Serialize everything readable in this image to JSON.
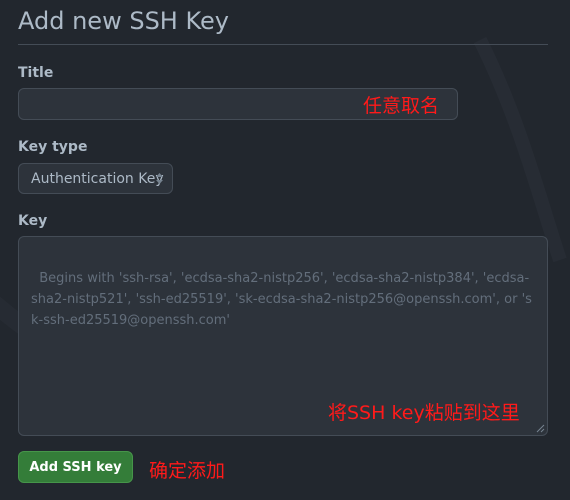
{
  "page": {
    "title": "Add new SSH Key"
  },
  "form": {
    "title_label": "Title",
    "title_value": "",
    "key_type_label": "Key type",
    "key_type_selected": "Authentication Key",
    "key_label": "Key",
    "key_placeholder": "Begins with 'ssh-rsa', 'ecdsa-sha2-nistp256', 'ecdsa-sha2-nistp384', 'ecdsa-sha2-nistp521', 'ssh-ed25519', 'sk-ecdsa-sha2-nistp256@openssh.com', or 'sk-ssh-ed25519@openssh.com'",
    "submit_label": "Add SSH key"
  },
  "annotations": {
    "title_note": "任意取名",
    "key_note": "将SSH key粘贴到这里",
    "submit_note": "确定添加"
  },
  "colors": {
    "background": "#22272e",
    "button_green": "#347d39",
    "annotation_red": "#ff1a1a"
  }
}
